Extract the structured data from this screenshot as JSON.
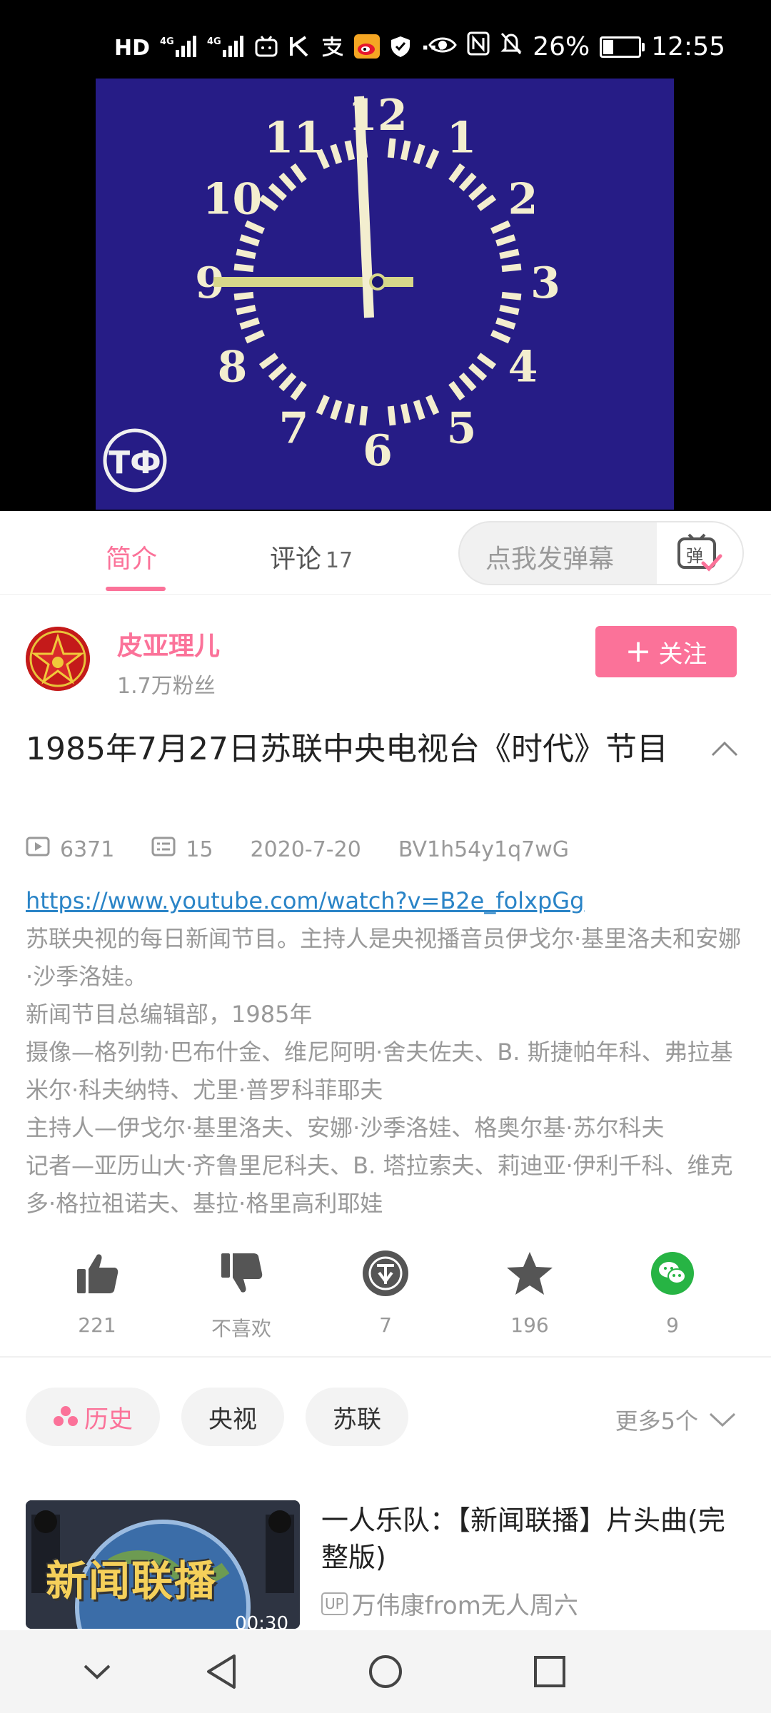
{
  "status_bar": {
    "hd_label": "HD",
    "sim1_label": "4G",
    "sim2_label": "4G",
    "battery_text": "26%",
    "battery_level": 0.26,
    "time": "12:55",
    "more_label": "···",
    "icons": [
      "hd-icon",
      "signal-icon",
      "signal-icon",
      "bilibili-icon",
      "k-icon",
      "alipay-icon",
      "weibo-icon",
      "shield-icon",
      "eye-icon",
      "nfc-icon",
      "mute-icon",
      "battery-icon"
    ]
  },
  "video": {
    "logo_text": "ТФ",
    "clock_numbers": [
      "12",
      "1",
      "2",
      "3",
      "4",
      "5",
      "6",
      "7",
      "8",
      "9",
      "10",
      "11"
    ],
    "colors": {
      "screen": "#261c86",
      "numerals": "#f3eecf",
      "hands": "#d7d78a"
    }
  },
  "tabs": {
    "intro": "简介",
    "comments": "评论",
    "comments_count": "17",
    "danmaku_placeholder": "点我发弹幕",
    "danmaku_button_icon": "danmaku-icon",
    "danmaku_button_char": "弹"
  },
  "uploader": {
    "name": "皮亚理儿",
    "fans": "1.7万粉丝",
    "follow_label": "关注",
    "follow_plus": "+"
  },
  "video_info": {
    "title": "1985年7月27日苏联中央电视台《时代》节目",
    "views": "6371",
    "danmaku_count": "15",
    "date": "2020-7-20",
    "bvid": "BV1h54y1q7wG"
  },
  "description": {
    "link": "https://www.youtube.com/watch?v=B2e_folxpGg",
    "lines": [
      "苏联央视的每日新闻节目。主持人是央视播音员伊戈尔·基里洛夫和安娜·沙季洛娃。",
      "新闻节目总编辑部，1985年",
      "摄像—格列勃·巴布什金、维尼阿明·舍夫佐夫、B. 斯捷帕年科、弗拉基米尔·科夫纳特、尤里·普罗科菲耶夫",
      "主持人—伊戈尔·基里洛夫、安娜·沙季洛娃、格奥尔基·苏尔科夫",
      "记者—亚历山大·齐鲁里尼科夫、B. 塔拉索夫、莉迪亚·伊利千科、维克多·格拉祖诺夫、基拉·格里高利耶娃"
    ]
  },
  "actions": {
    "like": "221",
    "dislike": "不喜欢",
    "coin": "7",
    "favorite": "196",
    "share": "9"
  },
  "tags": {
    "items": [
      "历史",
      "央视",
      "苏联"
    ],
    "more": "更多5个"
  },
  "recommendation": {
    "thumb_text": "新闻联播",
    "duration": "00:30",
    "title": "一人乐队：【新闻联播】片头曲(完整版)",
    "up_badge": "UP",
    "uploader": "万伟康from无人周六"
  },
  "accent_color": "#fb7299"
}
